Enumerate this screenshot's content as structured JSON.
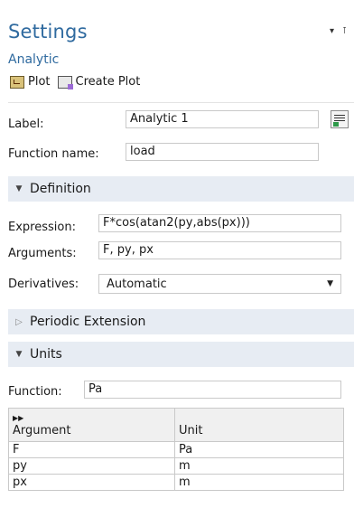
{
  "header": {
    "title": "Settings",
    "subtitle": "Analytic"
  },
  "window_controls": {
    "menu": "▾",
    "pin": "⊺"
  },
  "toolbar": {
    "plot_label": "Plot",
    "create_plot_label": "Create Plot"
  },
  "general": {
    "label_caption": "Label:",
    "label_value": "Analytic 1",
    "function_name_caption": "Function name:",
    "function_name_value": "load"
  },
  "definition": {
    "section_title": "Definition",
    "expression_caption": "Expression:",
    "expression_value": "F*cos(atan2(py,abs(px)))",
    "arguments_caption": "Arguments:",
    "arguments_value": "F, py, px",
    "derivatives_caption": "Derivatives:",
    "derivatives_value": "Automatic"
  },
  "periodic": {
    "section_title": "Periodic Extension"
  },
  "units": {
    "section_title": "Units",
    "function_caption": "Function:",
    "function_value": "Pa",
    "table": {
      "headers": {
        "argument": "Argument",
        "unit": "Unit"
      },
      "rows": [
        {
          "argument": "F",
          "unit": "Pa"
        },
        {
          "argument": "py",
          "unit": "m"
        },
        {
          "argument": "px",
          "unit": "m"
        }
      ]
    }
  }
}
